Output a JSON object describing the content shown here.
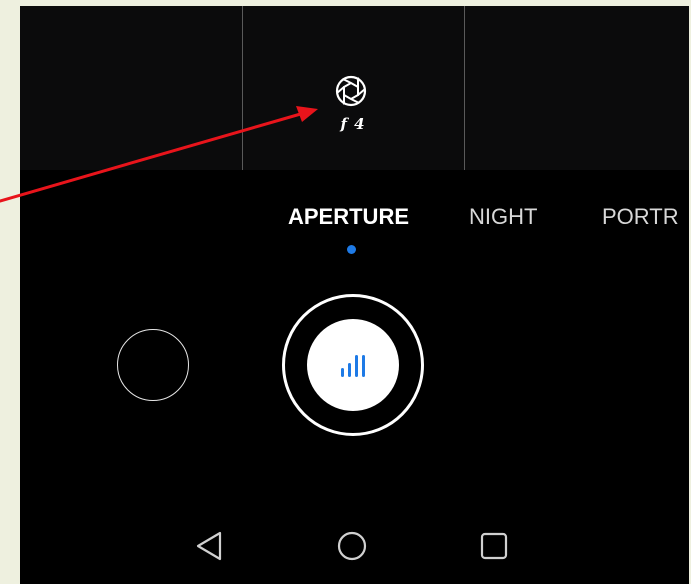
{
  "camera": {
    "aperture_value": "f 4",
    "aperture_icon": "aperture-icon",
    "modes": [
      {
        "label": "APERTURE",
        "selected": true
      },
      {
        "label": "NIGHT",
        "selected": false
      },
      {
        "label": "PORTR",
        "selected": false
      }
    ],
    "shutter_icon": "audio-bars-icon",
    "accent_color": "#1e7ae6"
  },
  "navigation": {
    "back_icon": "triangle-back-icon",
    "home_icon": "circle-home-icon",
    "recents_icon": "square-recents-icon"
  },
  "annotation": {
    "arrow_color": "#e8141b"
  }
}
